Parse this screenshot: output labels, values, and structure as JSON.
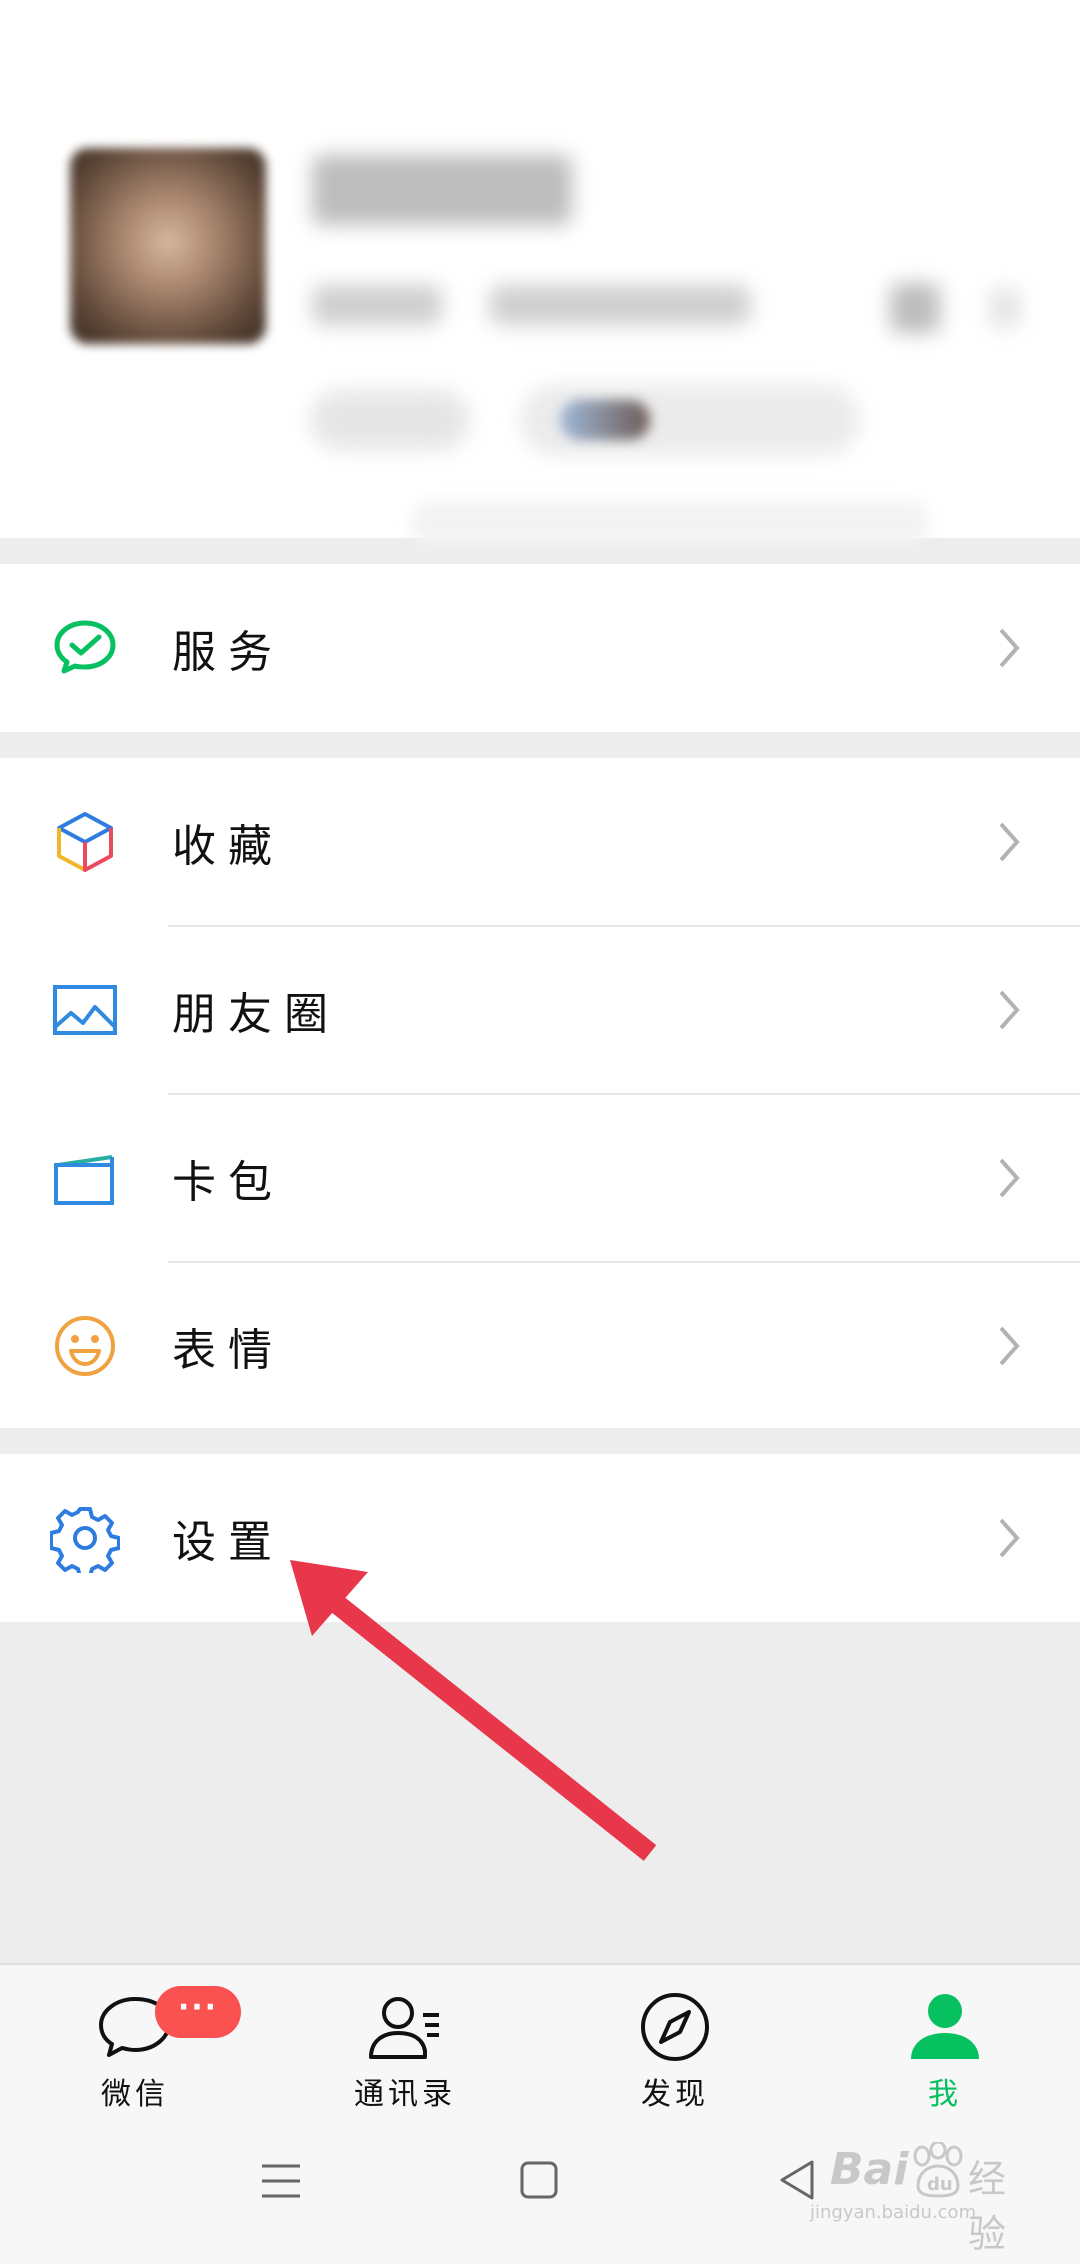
{
  "menu": {
    "services": {
      "label": "服务",
      "icon": "wechat-pay-check-icon"
    },
    "favorites": {
      "label": "收藏",
      "icon": "cube-icon"
    },
    "moments": {
      "label": "朋友圈",
      "icon": "picture-icon"
    },
    "cards": {
      "label": "卡包",
      "icon": "wallet-card-icon"
    },
    "stickers": {
      "label": "表情",
      "icon": "smiley-icon"
    },
    "settings": {
      "label": "设置",
      "icon": "gear-icon"
    }
  },
  "tabbar": {
    "chats": {
      "label": "微信",
      "icon": "chat-bubble-icon",
      "badge": "···"
    },
    "contacts": {
      "label": "通讯录",
      "icon": "contacts-icon"
    },
    "discover": {
      "label": "发现",
      "icon": "compass-icon"
    },
    "me": {
      "label": "我",
      "icon": "person-icon",
      "active": true
    }
  },
  "watermark": {
    "brand": "Bai",
    "text": "经验",
    "url": "jingyan.baidu.com"
  },
  "colors": {
    "accent": "#07c160",
    "badge": "#fa5151",
    "arrow": "#e8374a"
  }
}
